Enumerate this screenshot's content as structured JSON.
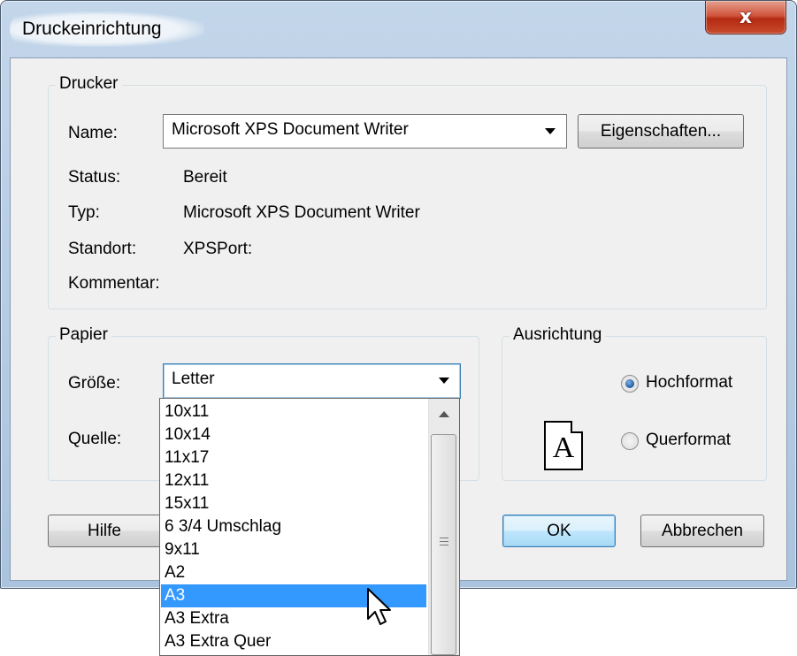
{
  "window": {
    "title": "Druckeinrichtung",
    "close_label": "x"
  },
  "printer": {
    "group_label": "Drucker",
    "name_label": "Name:",
    "name_value": "Microsoft XPS Document Writer",
    "properties_button": "Eigenschaften...",
    "status_label": "Status:",
    "status_value": "Bereit",
    "type_label": "Typ:",
    "type_value": "Microsoft XPS Document Writer",
    "location_label": "Standort:",
    "location_value": "XPSPort:",
    "comment_label": "Kommentar:"
  },
  "paper": {
    "group_label": "Papier",
    "size_label": "Größe:",
    "size_value": "Letter",
    "source_label": "Quelle:"
  },
  "orientation": {
    "group_label": "Ausrichtung",
    "icon_letter": "A",
    "portrait_label": "Hochformat",
    "landscape_label": "Querformat",
    "selected": "Hochformat"
  },
  "buttons": {
    "help": "Hilfe",
    "ok": "OK",
    "cancel": "Abbrechen"
  },
  "size_dropdown": {
    "items": [
      "10x11",
      "10x14",
      "11x17",
      "12x11",
      "15x11",
      "6 3/4 Umschlag",
      "9x11",
      "A2",
      "A3",
      "A3 Extra",
      "A3 Extra Quer"
    ],
    "highlighted": "A3"
  },
  "colors": {
    "highlight": "#3399ff",
    "dialog_bg": "#f0f0f0",
    "close_button": "#c8442a"
  }
}
